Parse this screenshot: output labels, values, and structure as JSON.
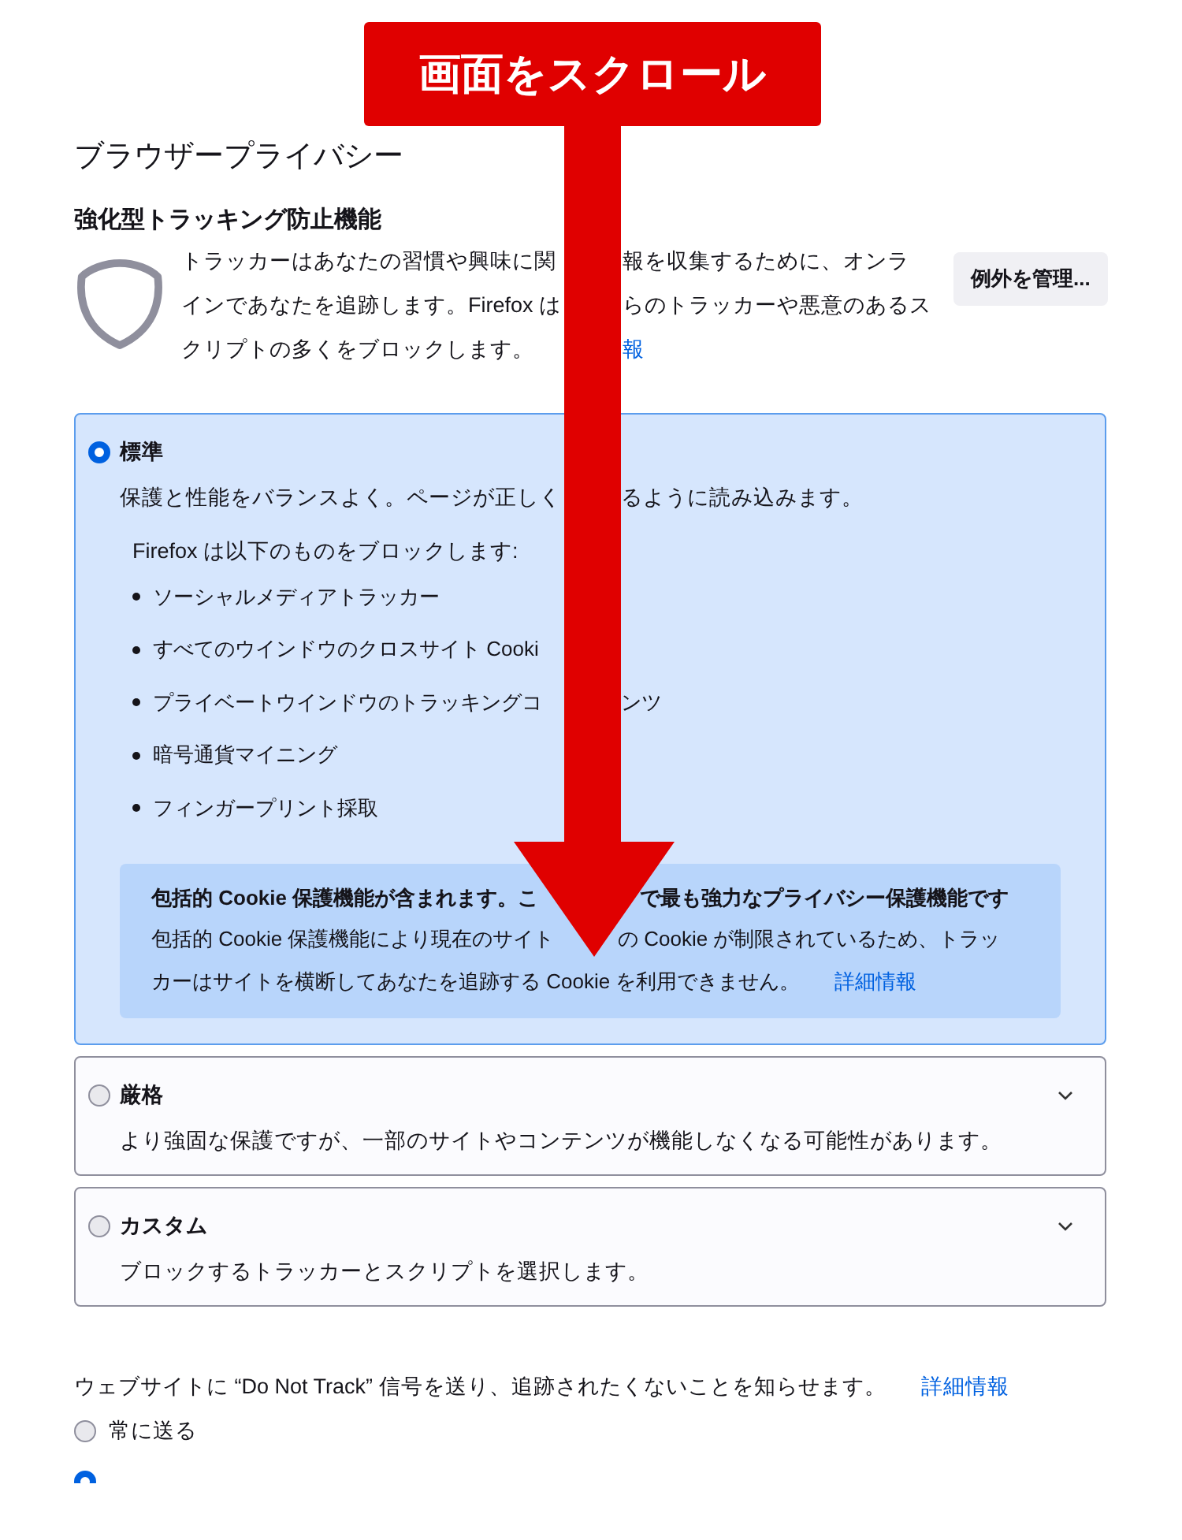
{
  "annotation": {
    "label": "画面をスクロール"
  },
  "section_title": "ブラウザープライバシー",
  "tracking": {
    "heading": "強化型トラッキング防止機能",
    "description_lines": [
      [
        "トラッカーはあなたの習慣や興味に関",
        "報を収集するために、オンラ"
      ],
      [
        "インであなたを追跡します。Firefox は",
        "らのトラッカーや悪意のあるス"
      ],
      [
        "クリプトの多くをブロックします。"
      ]
    ],
    "learn_more": "報",
    "manage_button": "例外を管理..."
  },
  "levels": [
    {
      "name": "標準",
      "selected": true,
      "description": [
        "保護と性能をバランスよく。ページが正しく",
        "るように読み込みます。"
      ],
      "blocks_heading": "Firefox は以下のものをブロックします:",
      "blocks": [
        [
          "ソーシャルメディアトラッカー"
        ],
        [
          "すべてのウインドウのクロスサイト Cooki"
        ],
        [
          "プライベートウインドウのトラッキングコ",
          "ンツ"
        ],
        [
          "暗号通貨マイニング"
        ],
        [
          "フィンガープリント採取"
        ]
      ],
      "notice": {
        "title": [
          "包括的 Cookie 保護機能が含まれます。こ",
          "で最も強力なプライバシー保護機能です"
        ],
        "text_lines": [
          [
            "包括的 Cookie 保護機能により現在のサイト",
            "の Cookie が制限されているため、トラッ"
          ],
          [
            "カーはサイトを横断してあなたを追跡する Cookie を利用できません。"
          ]
        ],
        "link": "詳細情報"
      }
    },
    {
      "name": "厳格",
      "selected": false,
      "description": [
        "より強固な保護ですが、一部のサイトやコンテンツが機能しなくなる可能性があります。"
      ]
    },
    {
      "name": "カスタム",
      "selected": false,
      "description": [
        "ブロックするトラッカーとスクリプトを選択します。"
      ]
    }
  ],
  "dnt": {
    "text": "ウェブサイトに “Do Not Track” 信号を送り、追跡されたくないことを知らせます。",
    "link": "詳細情報",
    "options": [
      {
        "label": "常に送る",
        "selected": false
      },
      {
        "selected": true
      }
    ]
  }
}
